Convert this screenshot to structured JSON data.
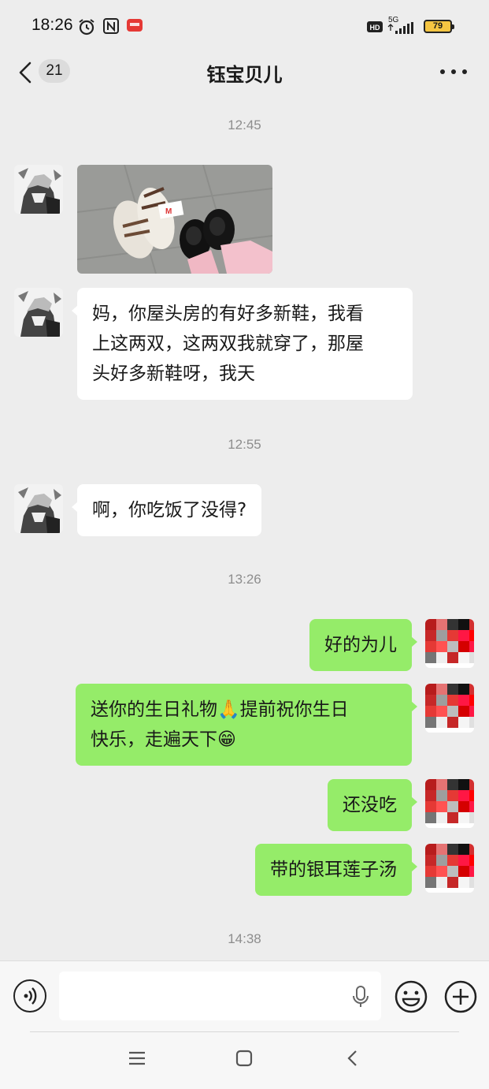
{
  "status_bar": {
    "time": "18:26",
    "network": "5G",
    "battery": "79"
  },
  "nav": {
    "unread_count": "21",
    "title": "钰宝贝儿"
  },
  "messages": [
    {
      "type": "timestamp",
      "text": "12:45"
    },
    {
      "type": "image",
      "side": "left"
    },
    {
      "type": "text",
      "side": "left",
      "lines": [
        "妈，你屋头房的有好多新鞋，我看",
        "上这两双，这两双我就穿了，那屋",
        "头好多新鞋呀，我天"
      ]
    },
    {
      "type": "timestamp",
      "text": "12:55"
    },
    {
      "type": "text",
      "side": "left",
      "lines": [
        "啊，你吃饭了没得?"
      ]
    },
    {
      "type": "timestamp",
      "text": "13:26"
    },
    {
      "type": "text",
      "side": "right",
      "lines": [
        "好的为儿"
      ]
    },
    {
      "type": "text",
      "side": "right",
      "lines": [
        "送你的生日礼物🙏提前祝你生日",
        "快乐，走遍天下😁"
      ]
    },
    {
      "type": "text",
      "side": "right",
      "lines": [
        "还没吃"
      ]
    },
    {
      "type": "text",
      "side": "right",
      "lines": [
        "带的银耳莲子汤"
      ]
    },
    {
      "type": "timestamp",
      "text": "14:38"
    }
  ],
  "input_bar": {
    "placeholder": ""
  },
  "colors": {
    "background": "#ededed",
    "outgoing_bubble": "#95ec69",
    "incoming_bubble": "#ffffff"
  },
  "icons": [
    "alarm-icon",
    "nfc-icon",
    "hd-icon",
    "signal-icon",
    "battery-icon",
    "back-icon",
    "more-icon",
    "voice-icon",
    "mic-icon",
    "emoji-icon",
    "plus-icon",
    "menu-icon",
    "home-icon",
    "back-nav-icon"
  ]
}
